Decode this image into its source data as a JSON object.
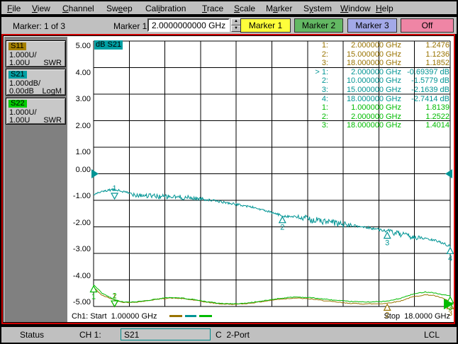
{
  "menu": {
    "items": [
      {
        "label": "File",
        "u": 0
      },
      {
        "label": "View",
        "u": 0
      },
      {
        "label": "Channel",
        "u": 0
      },
      {
        "label": "Sweep",
        "u": 2
      },
      {
        "label": "Calibration",
        "u": 3
      },
      {
        "label": "Trace",
        "u": 0
      },
      {
        "label": "Scale",
        "u": 0
      },
      {
        "label": "Marker",
        "u": 1
      },
      {
        "label": "System",
        "u": 1
      },
      {
        "label": "Window",
        "u": 0
      },
      {
        "label": "Help",
        "u": 0
      }
    ]
  },
  "marker_toolbar": {
    "readout": "Marker: 1 of 3",
    "field_label": "Marker 1",
    "field_value": "2.0000000000 GHz",
    "buttons": [
      {
        "label": "Marker 1",
        "color": "#ffff3b"
      },
      {
        "label": "Marker 2",
        "color": "#63b863"
      },
      {
        "label": "Marker 3",
        "color": "#a3a9e8"
      },
      {
        "label": "Off",
        "color": "#ef85a5"
      }
    ]
  },
  "sidebar": {
    "panels": [
      {
        "name": "S11",
        "chip_color": "#a58000",
        "scale": "1.000U/",
        "ref": "1.00U",
        "format": "SWR"
      },
      {
        "name": "S21",
        "chip_color": "#00a0a4",
        "scale": "1.000dB/",
        "ref": "0.00dB",
        "format": "LogM"
      },
      {
        "name": "S22",
        "chip_color": "#00cc00",
        "scale": "1.000U/",
        "ref": "1.00U",
        "format": "SWR"
      }
    ]
  },
  "plot": {
    "title_chip": "dB S21",
    "title_chip_bg": "#00a0a4",
    "start_label": "Ch1: Start  1.00000 GHz",
    "stop_label": "Stop  18.0000 GHz",
    "readouts": [
      {
        "group": "S11",
        "num": "1:",
        "freq": "2.000000 GHz",
        "val": "1.2476"
      },
      {
        "group": "S11",
        "num": "2:",
        "freq": "15.000000 GHz",
        "val": "1.1236"
      },
      {
        "group": "S11",
        "num": "3:",
        "freq": "18.000000 GHz",
        "val": "1.1852"
      },
      {
        "group": "S21",
        "num": "> 1:",
        "freq": "2.000000 GHz",
        "val": "-0.69397 dB"
      },
      {
        "group": "S21",
        "num": "2:",
        "freq": "10.000000 GHz",
        "val": "-1.5779 dB"
      },
      {
        "group": "S21",
        "num": "3:",
        "freq": "15.000000 GHz",
        "val": "-2.1639 dB"
      },
      {
        "group": "S21",
        "num": "4:",
        "freq": "18.000000 GHz",
        "val": "-2.7414 dB"
      },
      {
        "group": "S22",
        "num": "1:",
        "freq": "1.000000 GHz",
        "val": "1.8139"
      },
      {
        "group": "S22",
        "num": "2:",
        "freq": "2.000000 GHz",
        "val": "1.2522"
      },
      {
        "group": "S22",
        "num": "3:",
        "freq": "18.000000 GHz",
        "val": "1.4014"
      }
    ]
  },
  "status_bar": {
    "status": "Status",
    "channel": "CH 1:",
    "trace": "S21",
    "cal": "C  2-Port",
    "lcl": "LCL"
  },
  "colors": {
    "S11": "#997300",
    "S21": "#009494",
    "S22": "#00bb00"
  },
  "chart_data": {
    "type": "line",
    "title": "dB S21",
    "x_axis": {
      "label_start": "Ch1: Start 1.00000 GHz",
      "label_stop": "Stop 18.0000 GHz",
      "min_ghz": 1,
      "max_ghz": 18,
      "divisions": 10
    },
    "y_axis": {
      "min": -5,
      "max": 5,
      "step": 1,
      "tick_labels": [
        "5.00",
        "4.00",
        "3.00",
        "2.00",
        "1.00",
        "0.00",
        "-1.00",
        "-2.00",
        "-3.00",
        "-4.00",
        "-5.00"
      ],
      "reference_level": 0
    },
    "grid": true,
    "series": [
      {
        "name": "S11",
        "format": "SWR",
        "color": "#997300",
        "noise_amp": 0.015,
        "points": [
          [
            1,
            1.72
          ],
          [
            1.4,
            1.42
          ],
          [
            2,
            1.248
          ],
          [
            2.4,
            1.16
          ],
          [
            2.8,
            1.15
          ],
          [
            3.4,
            1.2
          ],
          [
            4,
            1.27
          ],
          [
            4.6,
            1.32
          ],
          [
            5.2,
            1.3
          ],
          [
            5.8,
            1.24
          ],
          [
            6.4,
            1.16
          ],
          [
            7,
            1.1
          ],
          [
            7.6,
            1.08
          ],
          [
            8.2,
            1.1
          ],
          [
            9,
            1.18
          ],
          [
            9.8,
            1.27
          ],
          [
            10.6,
            1.32
          ],
          [
            11.4,
            1.28
          ],
          [
            12.2,
            1.2
          ],
          [
            13,
            1.13
          ],
          [
            13.8,
            1.1
          ],
          [
            14.6,
            1.1
          ],
          [
            15,
            1.124
          ],
          [
            15.6,
            1.2
          ],
          [
            16.2,
            1.36
          ],
          [
            16.8,
            1.44
          ],
          [
            17.2,
            1.42
          ],
          [
            17.6,
            1.32
          ],
          [
            18,
            1.185
          ]
        ]
      },
      {
        "name": "S22",
        "format": "SWR",
        "color": "#00bb00",
        "noise_amp": 0.015,
        "points": [
          [
            1,
            1.814
          ],
          [
            1.4,
            1.5
          ],
          [
            2,
            1.252
          ],
          [
            2.4,
            1.17
          ],
          [
            2.8,
            1.16
          ],
          [
            3.4,
            1.21
          ],
          [
            4,
            1.28
          ],
          [
            4.6,
            1.34
          ],
          [
            5.2,
            1.32
          ],
          [
            5.8,
            1.26
          ],
          [
            6.4,
            1.18
          ],
          [
            7,
            1.12
          ],
          [
            7.6,
            1.1
          ],
          [
            8.2,
            1.12
          ],
          [
            9,
            1.2
          ],
          [
            9.8,
            1.3
          ],
          [
            10.6,
            1.36
          ],
          [
            11.4,
            1.33
          ],
          [
            12.2,
            1.26
          ],
          [
            13,
            1.2
          ],
          [
            13.8,
            1.17
          ],
          [
            14.6,
            1.18
          ],
          [
            15,
            1.2
          ],
          [
            15.6,
            1.3
          ],
          [
            16.2,
            1.46
          ],
          [
            16.8,
            1.55
          ],
          [
            17.2,
            1.52
          ],
          [
            17.6,
            1.45
          ],
          [
            18,
            1.401
          ]
        ]
      },
      {
        "name": "S21",
        "format": "LogM (dB)",
        "color": "#009494",
        "noise_profile": [
          [
            1,
            0.03
          ],
          [
            2.5,
            0.05
          ],
          [
            3,
            0.1
          ],
          [
            5.5,
            0.09
          ],
          [
            6.5,
            0.04
          ],
          [
            9.5,
            0.04
          ],
          [
            10.5,
            0.05
          ],
          [
            11,
            0.13
          ],
          [
            12.8,
            0.13
          ],
          [
            13.4,
            0.05
          ],
          [
            14.8,
            0.05
          ],
          [
            15.2,
            0.11
          ],
          [
            16.3,
            0.1
          ],
          [
            16.8,
            0.04
          ],
          [
            18,
            0.05
          ]
        ],
        "points": [
          [
            1,
            -0.78
          ],
          [
            1.4,
            -0.68
          ],
          [
            1.8,
            -0.61
          ],
          [
            2,
            -0.6
          ],
          [
            2.2,
            -0.63
          ],
          [
            2.6,
            -0.72
          ],
          [
            3,
            -0.78
          ],
          [
            3.6,
            -0.83
          ],
          [
            4.2,
            -0.86
          ],
          [
            5,
            -0.88
          ],
          [
            5.6,
            -0.91
          ],
          [
            6.2,
            -0.95
          ],
          [
            6.8,
            -1.02
          ],
          [
            7.4,
            -1.1
          ],
          [
            8,
            -1.18
          ],
          [
            8.6,
            -1.26
          ],
          [
            9.3,
            -1.42
          ],
          [
            10,
            -1.58
          ],
          [
            10.6,
            -1.63
          ],
          [
            11.2,
            -1.7
          ],
          [
            12,
            -1.8
          ],
          [
            12.7,
            -1.88
          ],
          [
            13.4,
            -1.96
          ],
          [
            14.2,
            -2.04
          ],
          [
            15,
            -2.16
          ],
          [
            15.6,
            -2.28
          ],
          [
            16.2,
            -2.38
          ],
          [
            16.8,
            -2.44
          ],
          [
            17.3,
            -2.52
          ],
          [
            17.7,
            -2.62
          ],
          [
            18,
            -2.74
          ]
        ]
      }
    ],
    "markers": [
      {
        "trace": "S11",
        "n": "1",
        "ghz": 2,
        "value": 1.2476,
        "style": "down"
      },
      {
        "trace": "S11",
        "n": "2",
        "ghz": 15,
        "value": 1.1236,
        "style": "up"
      },
      {
        "trace": "S11",
        "n": "3",
        "ghz": 18,
        "value": 1.1852,
        "style": "up"
      },
      {
        "trace": "S22",
        "n": "1",
        "ghz": 1,
        "value": 1.8139,
        "style": "up"
      },
      {
        "trace": "S22",
        "n": "2",
        "ghz": 2,
        "value": 1.2522,
        "style": "down"
      },
      {
        "trace": "S22",
        "n": "3",
        "ghz": 18,
        "value": 1.4014,
        "style": "up"
      },
      {
        "trace": "S21",
        "n": "1",
        "ghz": 2,
        "value": -0.69397,
        "style": "down",
        "active": true
      },
      {
        "trace": "S21",
        "n": "2",
        "ghz": 10,
        "value": -1.5779,
        "style": "up"
      },
      {
        "trace": "S21",
        "n": "3",
        "ghz": 15,
        "value": -2.1639,
        "style": "up"
      },
      {
        "trace": "S21",
        "n": "4",
        "ghz": 18,
        "value": -2.7414,
        "style": "up"
      }
    ]
  }
}
